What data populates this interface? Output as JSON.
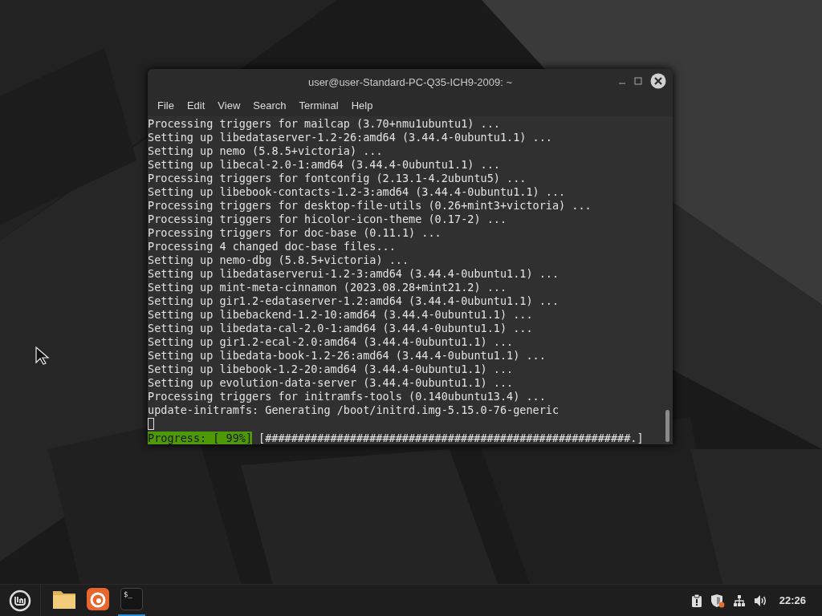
{
  "window": {
    "title": "user@user-Standard-PC-Q35-ICH9-2009: ~",
    "menu": [
      "File",
      "Edit",
      "View",
      "Search",
      "Terminal",
      "Help"
    ]
  },
  "terminal": {
    "lines": [
      "Processing triggers for mailcap (3.70+nmu1ubuntu1) ...",
      "Setting up libedataserver-1.2-26:amd64 (3.44.4-0ubuntu1.1) ...",
      "Setting up nemo (5.8.5+victoria) ...",
      "Setting up libecal-2.0-1:amd64 (3.44.4-0ubuntu1.1) ...",
      "Processing triggers for fontconfig (2.13.1-4.2ubuntu5) ...",
      "Setting up libebook-contacts-1.2-3:amd64 (3.44.4-0ubuntu1.1) ...",
      "Processing triggers for desktop-file-utils (0.26+mint3+victoria) ...",
      "Processing triggers for hicolor-icon-theme (0.17-2) ...",
      "Processing triggers for doc-base (0.11.1) ...",
      "Processing 4 changed doc-base files...",
      "Setting up nemo-dbg (5.8.5+victoria) ...",
      "Setting up libedataserverui-1.2-3:amd64 (3.44.4-0ubuntu1.1) ...",
      "Setting up mint-meta-cinnamon (2023.08.28+mint21.2) ...",
      "Setting up gir1.2-edataserver-1.2:amd64 (3.44.4-0ubuntu1.1) ...",
      "Setting up libebackend-1.2-10:amd64 (3.44.4-0ubuntu1.1) ...",
      "Setting up libedata-cal-2.0-1:amd64 (3.44.4-0ubuntu1.1) ...",
      "Setting up gir1.2-ecal-2.0:amd64 (3.44.4-0ubuntu1.1) ...",
      "Setting up libedata-book-1.2-26:amd64 (3.44.4-0ubuntu1.1) ...",
      "Setting up libebook-1.2-20:amd64 (3.44.4-0ubuntu1.1) ...",
      "Setting up evolution-data-server (3.44.4-0ubuntu1.1) ...",
      "Processing triggers for initramfs-tools (0.140ubuntu13.4) ...",
      "update-initramfs: Generating /boot/initrd.img-5.15.0-76-generic"
    ],
    "progress": {
      "label": "Progress: [ 99%]",
      "bar": "[########################################################.]"
    }
  },
  "taskbar": {
    "apps": [
      {
        "kind": "files",
        "active": false
      },
      {
        "kind": "browser",
        "active": false
      },
      {
        "kind": "terminal",
        "active": true,
        "glyph": "$_"
      }
    ],
    "clock": "22:26"
  }
}
